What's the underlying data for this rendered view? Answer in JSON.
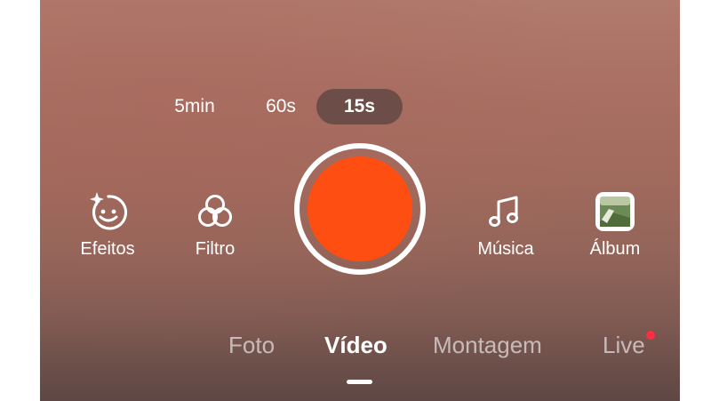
{
  "durations": {
    "d5min": "5min",
    "d60s": "60s",
    "d15s": "15s",
    "selected": "15s"
  },
  "tools": {
    "effects": "Efeitos",
    "filter": "Filtro",
    "music": "Música",
    "album": "Álbum"
  },
  "modes": {
    "photo": "Foto",
    "video": "Vídeo",
    "montage": "Montagem",
    "live": "Live",
    "selected": "Vídeo"
  },
  "colors": {
    "shutter": "#ff4e12",
    "live_badge": "#ff2d40",
    "selected_pill": "#6d4d47"
  },
  "icons": {
    "effects": "sparkle-smiley-icon",
    "filter": "overlapping-circles-icon",
    "music": "music-note-icon",
    "album": "gallery-thumbnail-icon"
  }
}
